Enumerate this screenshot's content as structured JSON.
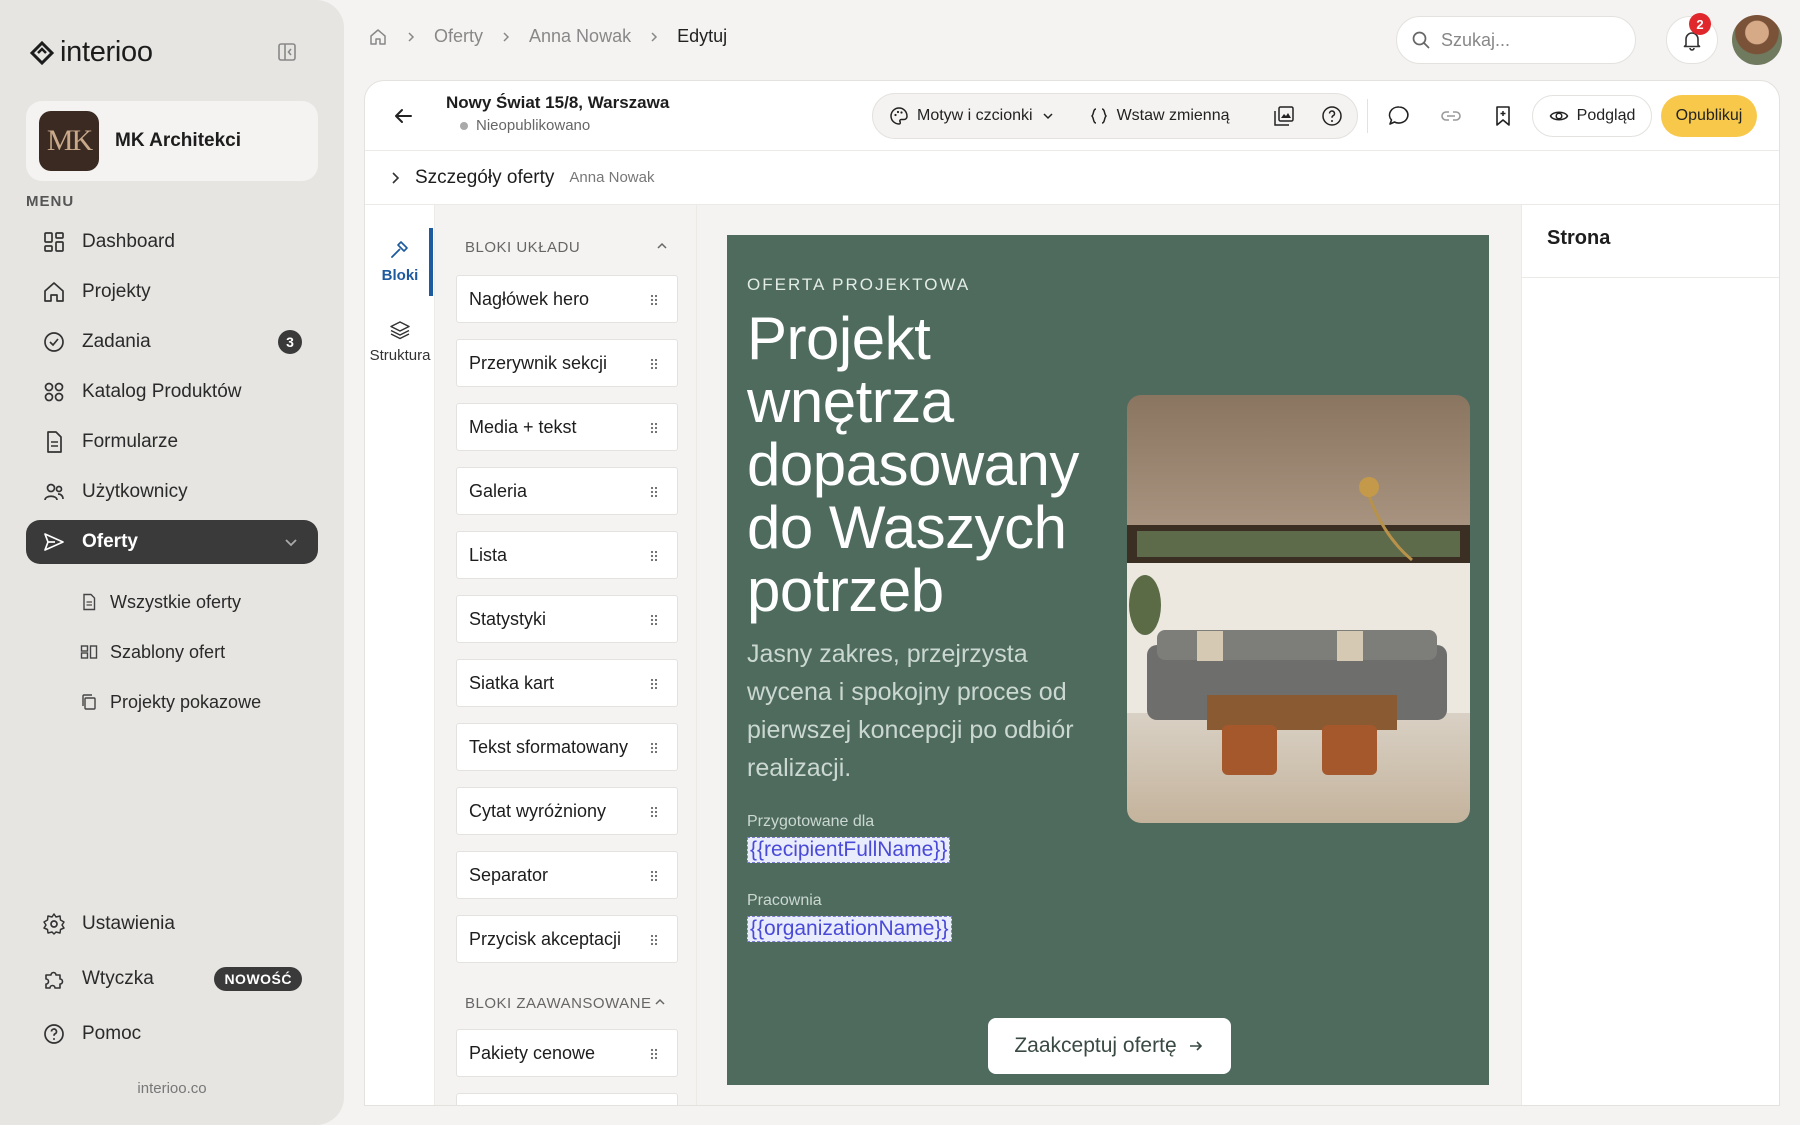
{
  "brand": {
    "name": "interioo",
    "footer": "interioo.co"
  },
  "org": {
    "initials": "MK",
    "name": "MK Architekci"
  },
  "menu_label": "MENU",
  "nav": [
    {
      "label": "Dashboard",
      "icon": "dashboard-icon"
    },
    {
      "label": "Projekty",
      "icon": "home-icon"
    },
    {
      "label": "Zadania",
      "icon": "check-circle-icon",
      "count": "3"
    },
    {
      "label": "Katalog Produktów",
      "icon": "grid-icon"
    },
    {
      "label": "Formularze",
      "icon": "document-icon"
    },
    {
      "label": "Użytkownicy",
      "icon": "users-icon"
    },
    {
      "label": "Oferty",
      "icon": "send-icon",
      "active": true
    }
  ],
  "subnav": [
    {
      "label": "Wszystkie oferty",
      "icon": "file-icon"
    },
    {
      "label": "Szablony ofert",
      "icon": "template-icon"
    },
    {
      "label": "Projekty pokazowe",
      "icon": "copy-icon"
    }
  ],
  "bottom_nav": [
    {
      "label": "Ustawienia",
      "icon": "gear-icon"
    },
    {
      "label": "Wtyczka",
      "icon": "puzzle-icon",
      "badge": "NOWOŚĆ"
    },
    {
      "label": "Pomoc",
      "icon": "help-icon"
    }
  ],
  "breadcrumbs": [
    "Oferty",
    "Anna Nowak",
    "Edytuj"
  ],
  "search": {
    "placeholder": "Szukaj..."
  },
  "notifications": {
    "count": "2"
  },
  "toolbar": {
    "doc_title": "Nowy Świat 15/8, Warszawa",
    "status": "Nieopublikowano",
    "theme_label": "Motyw i czcionki",
    "insert_var_label": "Wstaw zmienną",
    "preview_label": "Podgląd",
    "publish_label": "Opublikuj"
  },
  "details": {
    "title": "Szczegóły oferty",
    "client": "Anna Nowak"
  },
  "rail": [
    {
      "label": "Bloki",
      "icon": "hammer-icon",
      "active": true
    },
    {
      "label": "Struktura",
      "icon": "layers-icon"
    }
  ],
  "blocks": {
    "layout_heading": "BLOKI UKŁADU",
    "layout": [
      "Nagłówek hero",
      "Przerywnik sekcji",
      "Media + tekst",
      "Galeria",
      "Lista",
      "Statystyki",
      "Siatka kart",
      "Tekst sformatowany",
      "Cytat wyróżniony",
      "Separator",
      "Przycisk akceptacji"
    ],
    "advanced_heading": "BLOKI ZAAWANSOWANE",
    "advanced": [
      "Pakiety cenowe",
      "..."
    ]
  },
  "offer": {
    "eyebrow": "OFERTA PROJEKTOWA",
    "headline": "Projekt wnętrza dopasowany do Waszych potrzeb",
    "lead": "Jasny zakres, przejrzysta wycena i spokojny proces od pierwszej koncepcji po odbiór realizacji.",
    "prepared_for_label": "Przygotowane dla",
    "prepared_for_var": "{{recipientFullName}}",
    "studio_label": "Pracownia",
    "studio_var": "{{organizationName}}",
    "accept_label": "Zaakceptuj ofertę",
    "bg_color": "#4e6b5e"
  },
  "props": {
    "title": "Strona"
  },
  "colors": {
    "accent": "#f7c84a",
    "active_nav": "#3a3a3a",
    "rail_active": "#1e5a9e",
    "notification": "#e0282c"
  }
}
